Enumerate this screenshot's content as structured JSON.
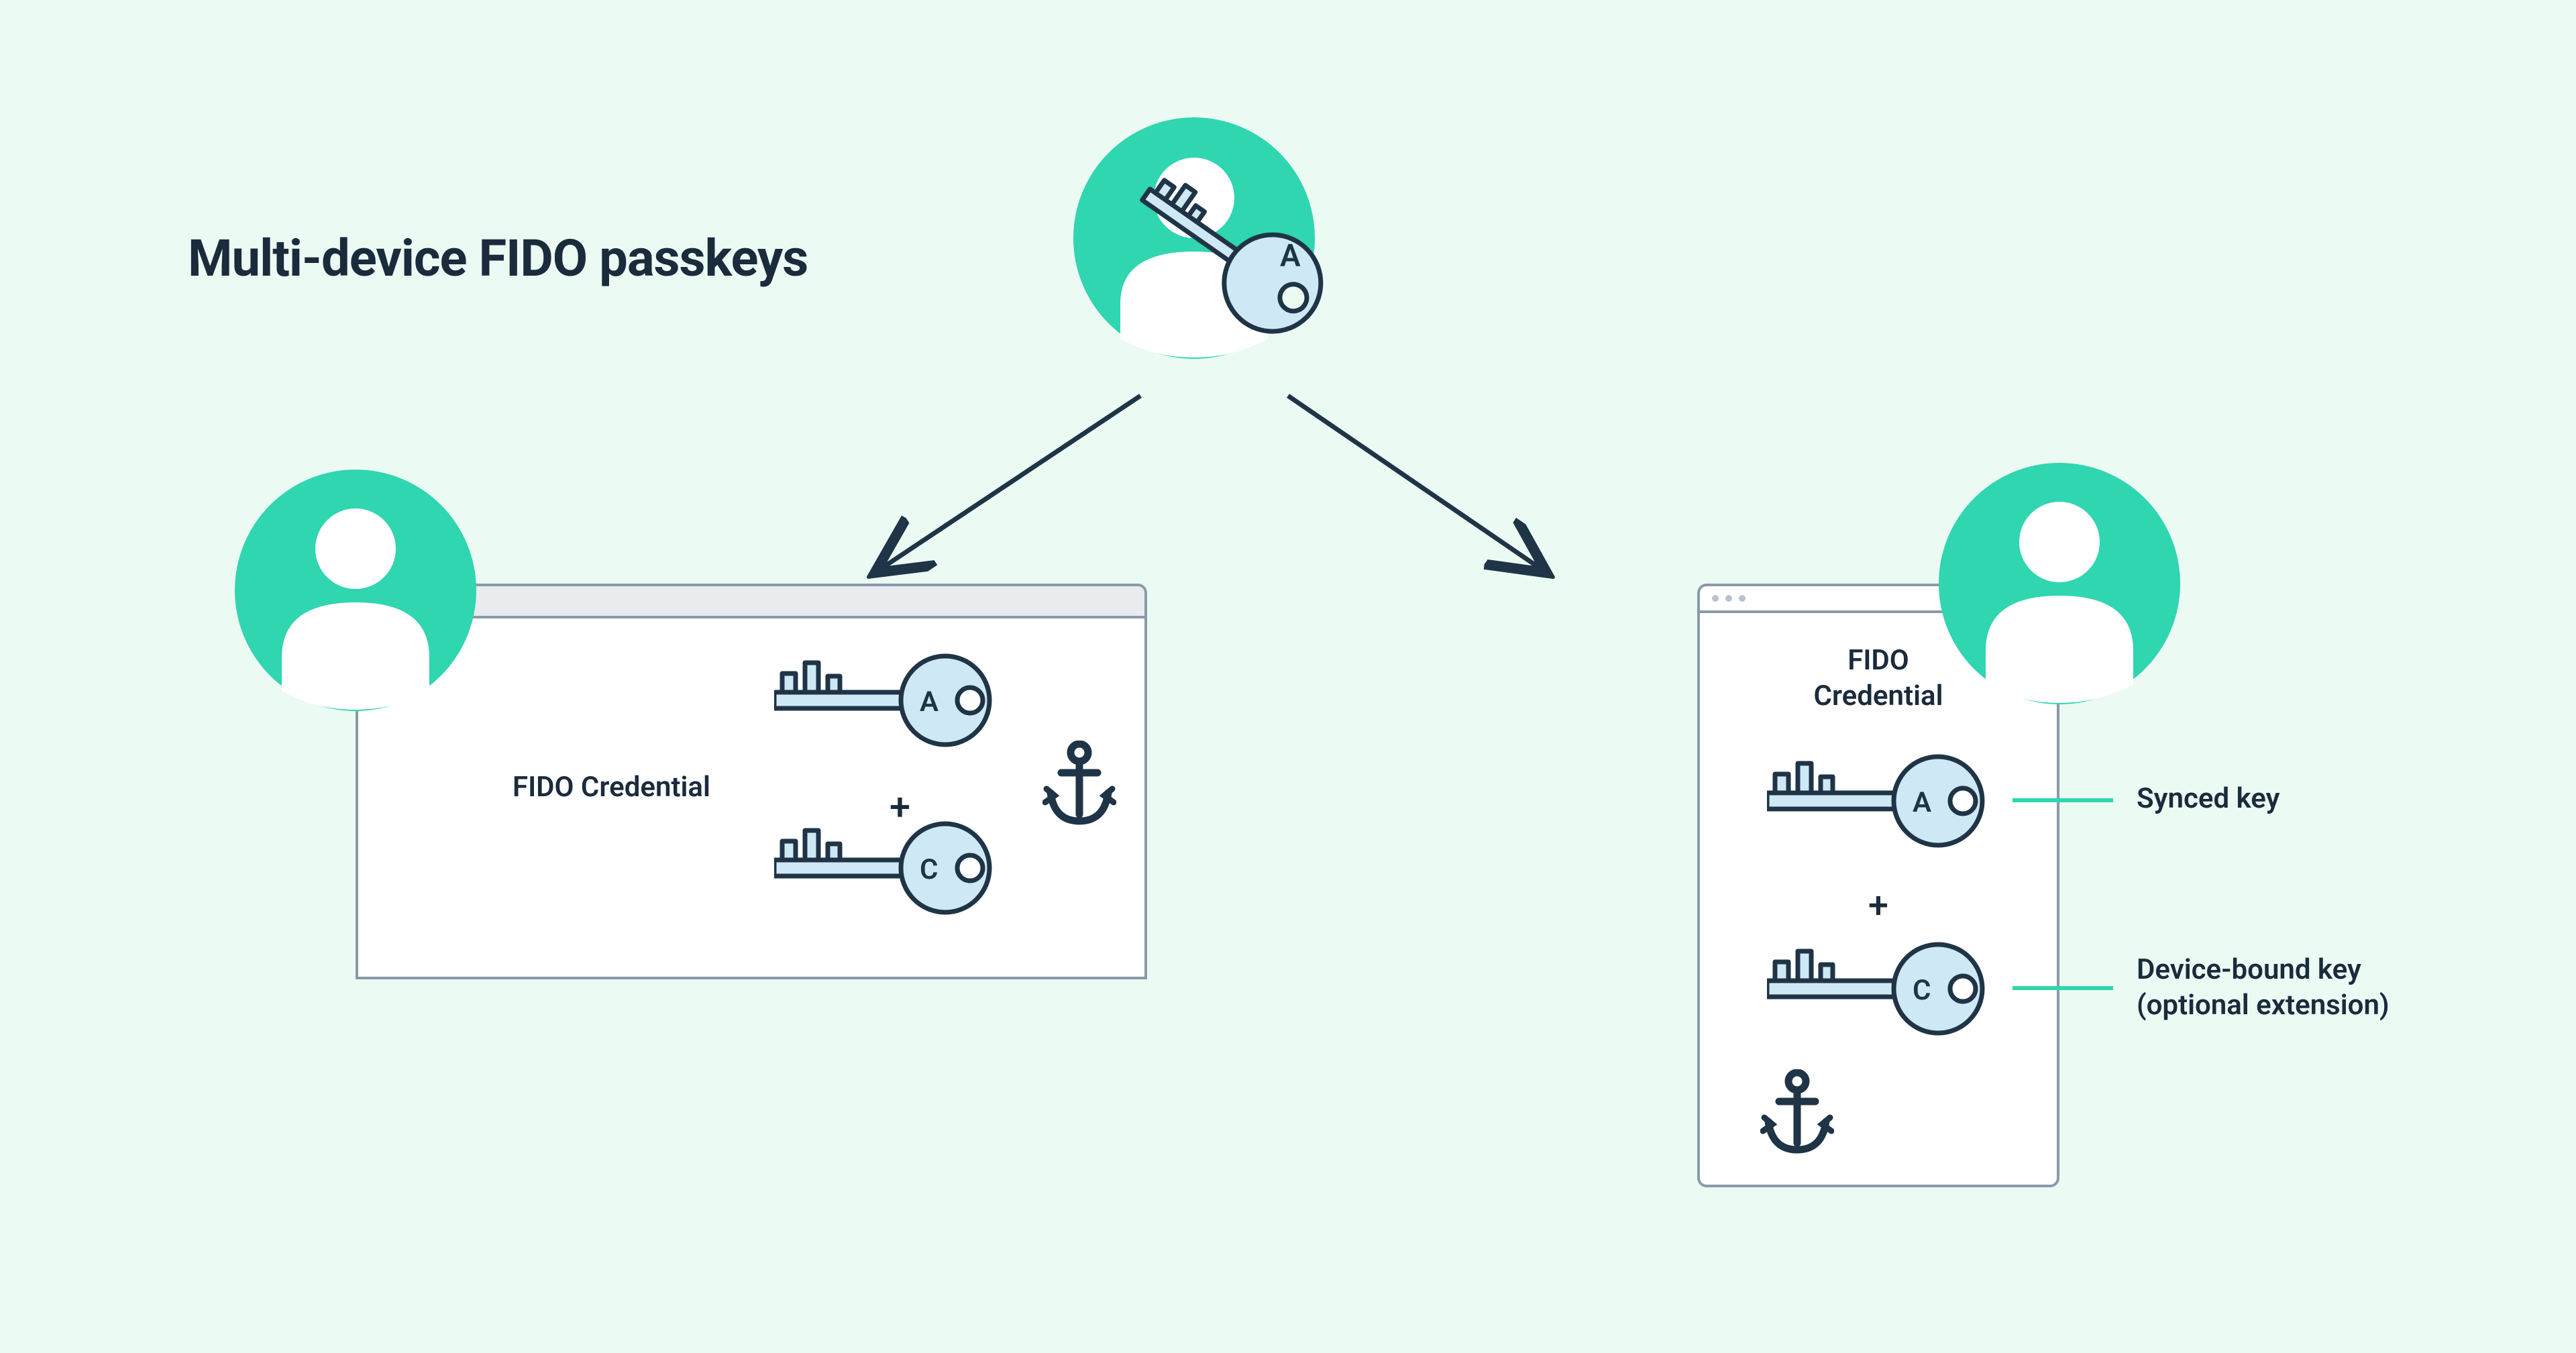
{
  "title": "Multi-device FIDO passkeys",
  "browser": {
    "label": "FIDO Credential",
    "plus": "+",
    "keys": {
      "a": "A",
      "c": "C"
    }
  },
  "mobile": {
    "label_line1": "FIDO",
    "label_line2": "Credential",
    "plus": "+",
    "keys": {
      "a": "A",
      "c": "C"
    }
  },
  "top_key_letter": "A",
  "legend": {
    "synced": "Synced key",
    "device_bound_line1": "Device-bound key",
    "device_bound_line2": "(optional extension)"
  },
  "colors": {
    "bg": "#ebfaf3",
    "accent": "#2fd6b0",
    "stroke": "#1f3446",
    "key_fill": "#cfe8f5",
    "window_stroke": "#8a9aa8"
  }
}
